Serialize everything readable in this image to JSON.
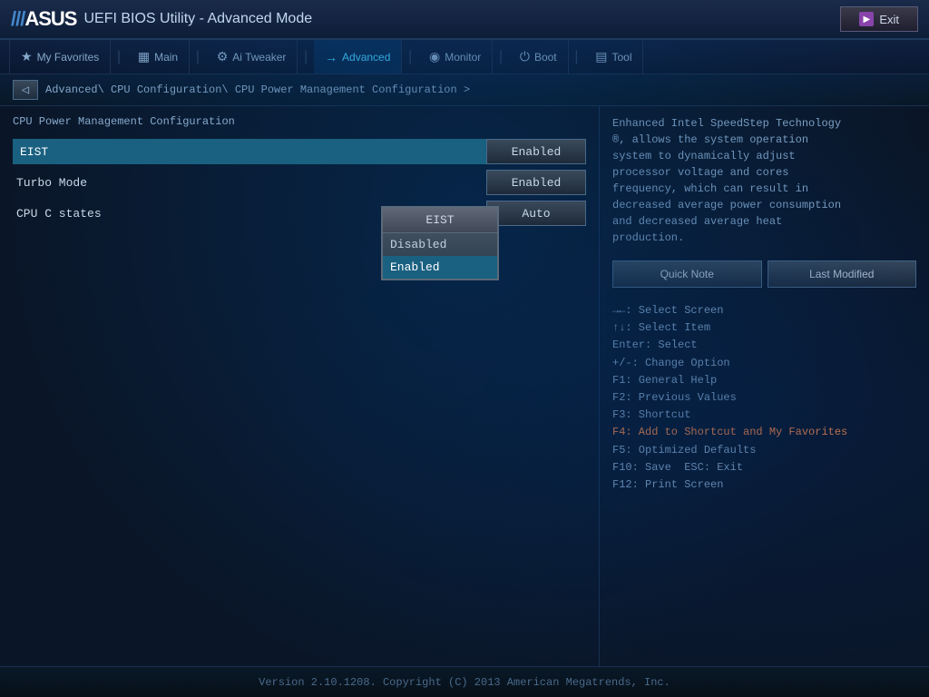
{
  "header": {
    "logo": "ASUS",
    "title": "UEFI BIOS Utility - Advanced Mode",
    "exit_label": "Exit"
  },
  "nav": {
    "items": [
      {
        "id": "favorites",
        "label": "My Favorites",
        "icon": "★",
        "active": false
      },
      {
        "id": "main",
        "label": "Main",
        "icon": "≡",
        "active": false
      },
      {
        "id": "ai_tweaker",
        "label": "Ai Tweaker",
        "icon": "⚙",
        "active": false
      },
      {
        "id": "advanced",
        "label": "Advanced",
        "icon": "→",
        "active": true
      },
      {
        "id": "monitor",
        "label": "Monitor",
        "icon": "◉",
        "active": false
      },
      {
        "id": "boot",
        "label": "Boot",
        "icon": "⏻",
        "active": false
      },
      {
        "id": "tool",
        "label": "Tool",
        "icon": "🖨",
        "active": false
      }
    ]
  },
  "breadcrumb": {
    "text": "Advanced\\ CPU Configuration\\ CPU Power Management Configuration >"
  },
  "section": {
    "title": "CPU Power Management Configuration",
    "items": [
      {
        "label": "EIST",
        "value": "Enabled",
        "selected": true
      },
      {
        "label": "Turbo Mode",
        "value": "Enabled",
        "selected": false
      },
      {
        "label": "CPU C states",
        "value": "Auto",
        "selected": false
      }
    ]
  },
  "dropdown": {
    "title": "EIST",
    "options": [
      {
        "label": "Disabled",
        "selected": false
      },
      {
        "label": "Enabled",
        "selected": true
      }
    ]
  },
  "description": {
    "text": "Enhanced Intel SpeedStep Technology\n®, allows the system operation\nsystem to dynamically adjust\nprocessor voltage and cores\nfrequency, which can result in\ndecreased average power consumption\nand decreased average heat\nproduction."
  },
  "action_buttons": {
    "quick_note": "Quick Note",
    "last_modified": "Last Modified"
  },
  "shortcuts": [
    {
      "key": "→←: Select Screen",
      "highlight": false
    },
    {
      "key": "↑↓: Select Item",
      "highlight": false
    },
    {
      "key": "Enter: Select",
      "highlight": false
    },
    {
      "key": "+/-: Change Option",
      "highlight": false
    },
    {
      "key": "F1: General Help",
      "highlight": false
    },
    {
      "key": "F2: Previous Values",
      "highlight": false
    },
    {
      "key": "F3: Shortcut",
      "highlight": false
    },
    {
      "key": "F4: Add to Shortcut and My Favorites",
      "highlight": true
    },
    {
      "key": "F5: Optimized Defaults",
      "highlight": false
    },
    {
      "key": "F10: Save  ESC: Exit",
      "highlight": false
    },
    {
      "key": "F12: Print Screen",
      "highlight": false
    }
  ],
  "footer": {
    "text": "Version 2.10.1208. Copyright (C) 2013 American Megatrends, Inc."
  }
}
